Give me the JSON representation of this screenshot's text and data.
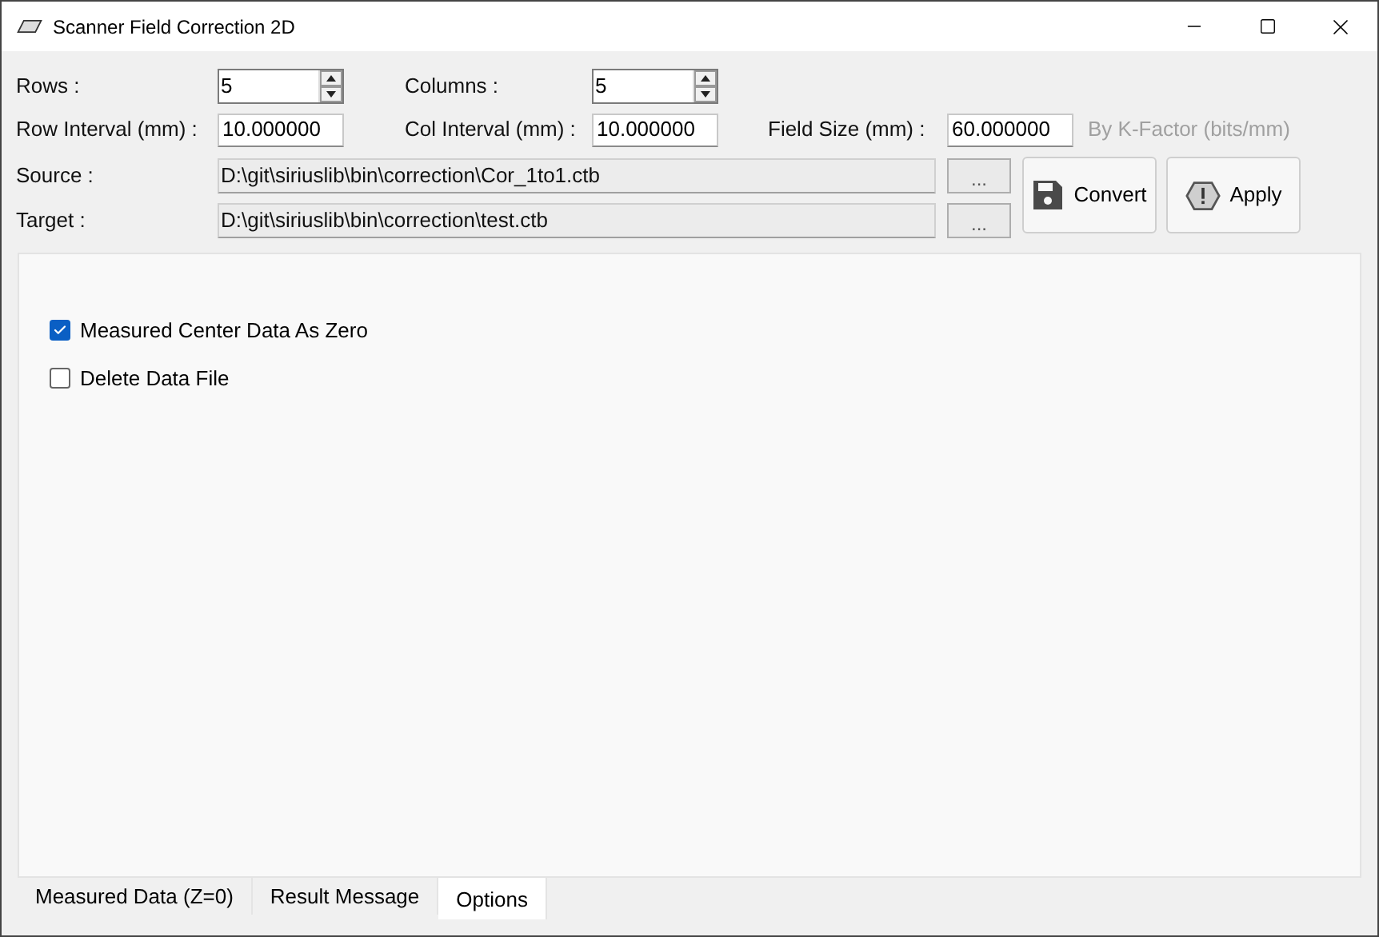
{
  "window": {
    "title": "Scanner Field Correction 2D"
  },
  "rows": {
    "label": "Rows :",
    "value": "5"
  },
  "columns": {
    "label": "Columns :",
    "value": "5"
  },
  "row_interval": {
    "label": "Row Interval (mm) :",
    "value": "10.000000"
  },
  "col_interval": {
    "label": "Col Interval (mm) :",
    "value": "10.000000"
  },
  "field_size": {
    "label": "Field Size (mm) :",
    "value": "60.000000"
  },
  "k_factor": {
    "label": "By K-Factor (bits/mm)",
    "disabled": true
  },
  "source": {
    "label": "Source :",
    "value": "D:\\git\\siriuslib\\bin\\correction\\Cor_1to1.ctb",
    "browse": "..."
  },
  "target": {
    "label": "Target :",
    "value": "D:\\git\\siriuslib\\bin\\correction\\test.ctb",
    "browse": "..."
  },
  "buttons": [
    {
      "label": "Convert",
      "kind": "save"
    },
    {
      "label": "Apply",
      "kind": "warning"
    }
  ],
  "options": [
    {
      "label": "Measured Center Data As Zero",
      "checked": true
    },
    {
      "label": "Delete Data File",
      "checked": false
    }
  ],
  "tabs": [
    {
      "label": "Measured Data (Z=0)",
      "selected": false
    },
    {
      "label": "Result Message",
      "selected": false
    },
    {
      "label": "Options",
      "selected": true
    }
  ]
}
